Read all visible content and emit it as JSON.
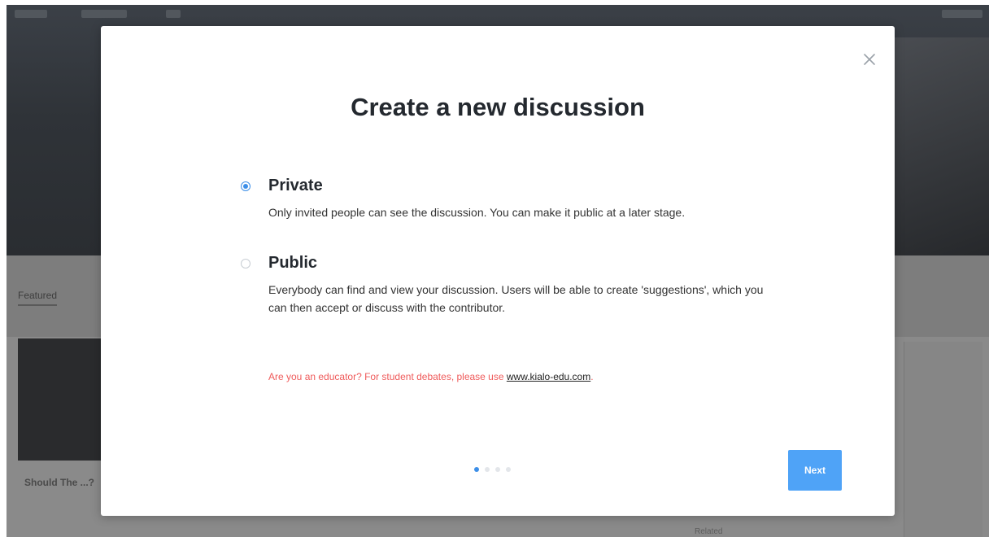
{
  "background": {
    "featured_tab": "Featured",
    "card_text": "Should The ...?",
    "bottom_item": "Related"
  },
  "modal": {
    "title": "Create a new discussion",
    "close_icon": "close-icon",
    "options": [
      {
        "label": "Private",
        "description": "Only invited people can see the discussion. You can make it public at a later stage.",
        "selected": true
      },
      {
        "label": "Public",
        "description": "Everybody can find and view your discussion. Users will be able to create 'suggestions', which you can then accept or discuss with the contributor.",
        "selected": false
      }
    ],
    "educator_note": {
      "text": "Are you an educator? For student debates, please use ",
      "link_text": "www.kialo-edu.com",
      "suffix": "."
    },
    "pager": {
      "total_steps": 4,
      "current_step": 1
    },
    "next_label": "Next"
  },
  "colors": {
    "accent": "#3d8fe8",
    "button": "#4fa3f7",
    "warning_text": "#ef5b5b",
    "title_text": "#24292f"
  }
}
